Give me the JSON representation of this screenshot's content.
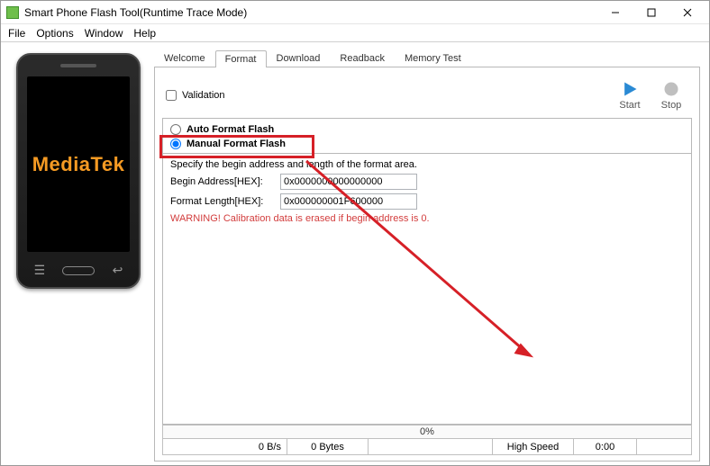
{
  "window": {
    "title": "Smart Phone Flash Tool(Runtime Trace Mode)"
  },
  "menu": {
    "file": "File",
    "options": "Options",
    "window": "Window",
    "help": "Help"
  },
  "phone": {
    "brand": "MediaTek"
  },
  "tabs": {
    "welcome": "Welcome",
    "format": "Format",
    "download": "Download",
    "readback": "Readback",
    "memory_test": "Memory Test"
  },
  "toolbar": {
    "validation_label": "Validation",
    "start": "Start",
    "stop": "Stop"
  },
  "format_options": {
    "auto": "Auto Format Flash",
    "manual": "Manual Format Flash"
  },
  "fields": {
    "desc": "Specify the begin address and length of the format area.",
    "begin_label": "Begin Address[HEX]:",
    "begin_value": "0x0000000000000000",
    "length_label": "Format Length[HEX]:",
    "length_value": "0x000000001F600000",
    "warning": "WARNING! Calibration data is erased if begin address is 0."
  },
  "progress": {
    "percent": "0%"
  },
  "status": {
    "rate": "0 B/s",
    "bytes": "0 Bytes",
    "mode": "High Speed",
    "time": "0:00"
  }
}
